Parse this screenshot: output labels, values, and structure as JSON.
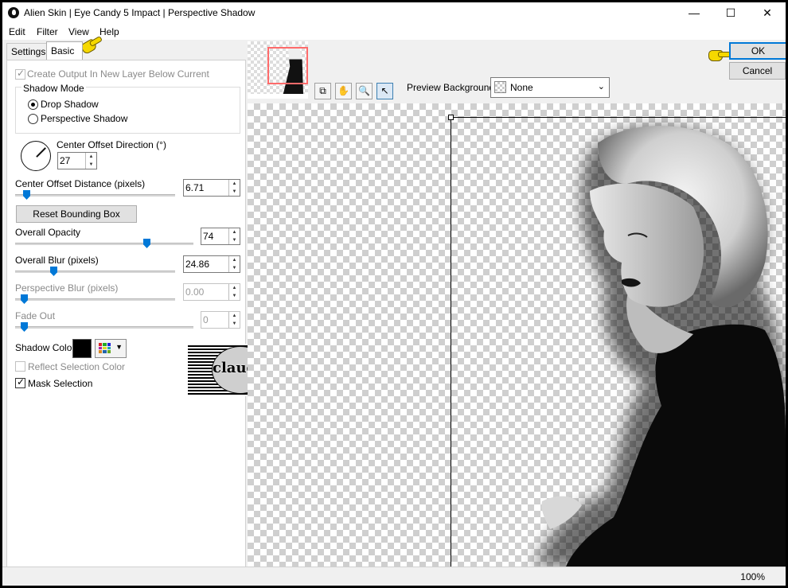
{
  "window": {
    "title": "Alien Skin | Eye Candy 5 Impact | Perspective Shadow",
    "controls": {
      "minimize": "—",
      "maximize": "☐",
      "close": "✕"
    }
  },
  "menu": {
    "items": [
      "Edit",
      "Filter",
      "View",
      "Help"
    ]
  },
  "tabs": {
    "settings": "Settings",
    "basic": "Basic"
  },
  "options": {
    "create_output": {
      "label": "Create Output In New Layer Below Current",
      "checked": true,
      "enabled": false
    },
    "shadow_mode": {
      "title": "Shadow Mode",
      "drop": "Drop Shadow",
      "perspective": "Perspective Shadow",
      "selected": "Drop Shadow"
    },
    "center_offset_direction": {
      "label": "Center Offset Direction (°)",
      "value": "27"
    },
    "center_offset_distance": {
      "label": "Center Offset Distance (pixels)",
      "value": "6.71"
    },
    "reset_button": "Reset Bounding Box",
    "overall_opacity": {
      "label": "Overall Opacity",
      "value": "74"
    },
    "overall_blur": {
      "label": "Overall Blur (pixels)",
      "value": "24.86"
    },
    "perspective_blur": {
      "label": "Perspective Blur (pixels)",
      "value": "0.00",
      "enabled": false
    },
    "fade_out": {
      "label": "Fade Out",
      "value": "0",
      "enabled": false
    },
    "shadow_color": {
      "label": "Shadow Color",
      "color": "#000000"
    },
    "reflect_selection_color": {
      "label": "Reflect Selection Color",
      "checked": false,
      "enabled": false
    },
    "mask_selection": {
      "label": "Mask Selection",
      "checked": true
    }
  },
  "buttons": {
    "ok": "OK",
    "cancel": "Cancel"
  },
  "preview": {
    "background_label": "Preview Background:",
    "background_value": "None",
    "zoom": "100%"
  },
  "watermark": {
    "text": "claudia"
  },
  "colors": {
    "accent": "#0078d7",
    "hand_pointer": "#f5d800",
    "thumb_frame": "#ff6b6b"
  }
}
